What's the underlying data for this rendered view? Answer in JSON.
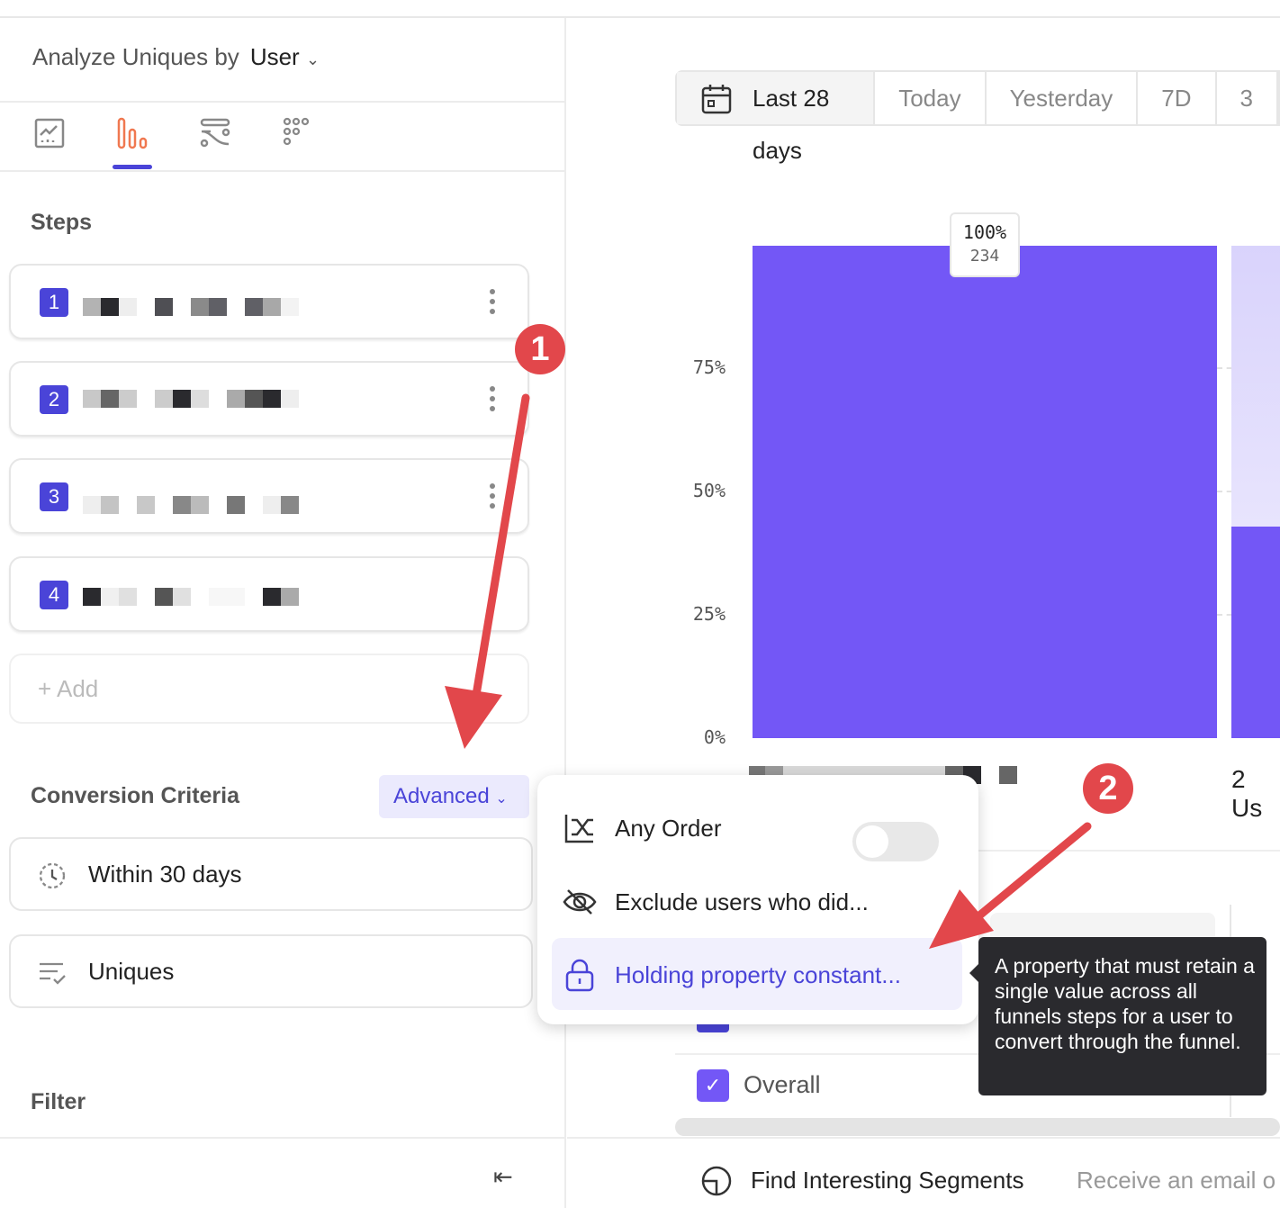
{
  "sidebar": {
    "analyze_label": "Analyze Uniques by",
    "analyze_value": "User",
    "chart_types": [
      "insights-icon",
      "funnels-icon",
      "flows-icon",
      "retention-icon"
    ],
    "active_chart_type": 1,
    "steps_title": "Steps",
    "steps": [
      {
        "number": "1"
      },
      {
        "number": "2"
      },
      {
        "number": "3"
      },
      {
        "number": "4"
      }
    ],
    "add_label": "Add",
    "conversion_title": "Conversion Criteria",
    "advanced_label": "Advanced",
    "window_label": "Within 30 days",
    "counting_label": "Uniques",
    "filter_title": "Filter"
  },
  "date_range": {
    "options": [
      "Last 28 days",
      "Today",
      "Yesterday",
      "7D",
      "3"
    ],
    "selected": "Last 28 days"
  },
  "chart_data": {
    "type": "bar",
    "yticks": [
      "0%",
      "25%",
      "50%",
      "75%"
    ],
    "ylim": [
      0,
      100
    ],
    "bars": [
      {
        "value": 100,
        "count_label": "234",
        "pct_label": "100%"
      },
      {
        "value": 43,
        "label": "2 Us"
      }
    ],
    "colors": {
      "bar": "#7357f6",
      "bar_bg": "#e4e0fd"
    }
  },
  "menu": {
    "items": [
      {
        "label": "Any Order",
        "toggle": false
      },
      {
        "label": "Exclude users who did..."
      },
      {
        "label": "Holding property constant..."
      }
    ],
    "highlighted": 2
  },
  "tooltip": "A property that must retain a single value across all funnels steps for a user to convert through the funnel.",
  "legend": {
    "overall_label": "Overall",
    "overall_checked": true
  },
  "footer": {
    "segments_label": "Find Interesting Segments",
    "email_label": "Receive an email o"
  },
  "annotations": [
    "1",
    "2"
  ],
  "colors": {
    "accent": "#4a44d8",
    "annotation": "#e2474b"
  }
}
